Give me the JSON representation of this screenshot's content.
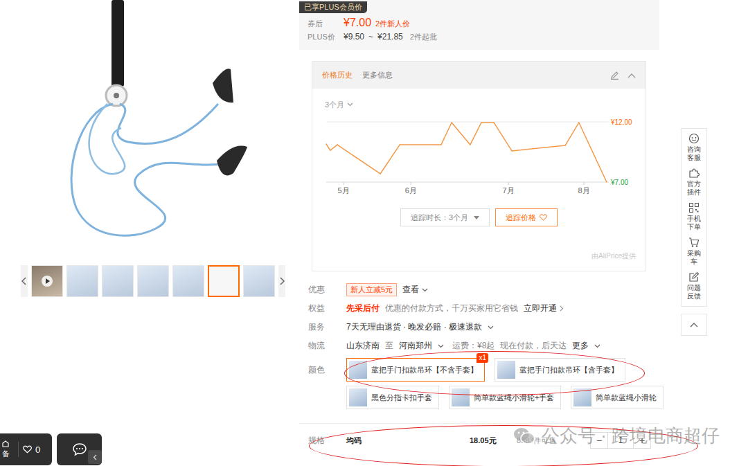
{
  "plus_badge": "已享PLUS会员价",
  "price": {
    "label": "券后",
    "value": "¥7.00",
    "note": "2件新人价"
  },
  "plus_price": {
    "label": "PLUS价",
    "low": "¥9.50",
    "separator": "~",
    "high": "¥21.85",
    "note": "2件起批"
  },
  "gallery": {
    "thumbnails": [
      {
        "kind": "video",
        "selected": false
      },
      {
        "kind": "image",
        "selected": false
      },
      {
        "kind": "image",
        "selected": false
      },
      {
        "kind": "image",
        "selected": false
      },
      {
        "kind": "image",
        "selected": false
      },
      {
        "kind": "image",
        "selected": true
      },
      {
        "kind": "image",
        "selected": false
      }
    ]
  },
  "price_history": {
    "tabs": [
      {
        "label": "价格历史",
        "selected": true
      },
      {
        "label": "更多信息",
        "selected": false
      }
    ],
    "range": "3个月",
    "y_max": 12,
    "y_min": 7,
    "y_max_label": "¥12.00",
    "y_min_label": "¥7.00",
    "months": [
      {
        "label": "5月",
        "day": 5.6
      },
      {
        "label": "6月",
        "day": 27.4
      },
      {
        "label": "7月",
        "day": 59
      },
      {
        "label": "8月",
        "day": 83.4
      }
    ],
    "series": {
      "days": [
        0,
        1.3,
        3.6,
        17.5,
        23.8,
        37.2,
        40.6,
        46.6,
        50.2,
        54.3,
        60.1,
        77.4,
        81.8,
        90.8
      ],
      "values": [
        10.16,
        9.64,
        10.1,
        7.69,
        10.1,
        10.1,
        11.94,
        10.1,
        11.94,
        11.94,
        9.59,
        10.05,
        11.94,
        7.0
      ]
    },
    "track_duration": "追踪时长：3个月",
    "track_price": "追踪价格",
    "provider": "由AliPrice提供"
  },
  "discount": {
    "label": "优惠",
    "tag": "新人立减5元",
    "link": "查看"
  },
  "benefit": {
    "label": "权益",
    "title": "先采后付",
    "text": "优惠的付款方式，千万买家用它省钱",
    "link": "立即开通"
  },
  "service": {
    "label": "服务",
    "text": "7天无理由退货 · 晚发必赔 · 极速退款"
  },
  "logistics": {
    "label": "物流",
    "from": "山东济南",
    "to_word": "至",
    "to": "河南郑州",
    "fee": "运费：¥8起",
    "delivery": "现在付款，后天达",
    "more": "更多"
  },
  "color": {
    "label": "颜色",
    "option_rows": [
      [
        {
          "name": "蓝把手门扣款吊环【不含手套】",
          "selected": true,
          "count": "x1"
        },
        {
          "name": "蓝把手门扣款吊环【含手套】",
          "selected": false
        }
      ],
      [
        {
          "name": "黑色分指卡扣手套",
          "selected": false
        },
        {
          "name": "简单款蓝绳小滑轮+手套",
          "selected": false
        },
        {
          "name": "简单款蓝绳小滑轮",
          "selected": false
        }
      ]
    ]
  },
  "spec": {
    "label": "规格",
    "name": "均码",
    "price": "18.05元",
    "stock": "8883件可售",
    "minus": "−",
    "quantity": "1",
    "plus": "+"
  },
  "toolbar": {
    "items": [
      {
        "label": "咨询客服",
        "kind": "chat"
      },
      {
        "label": "官方插件",
        "kind": "plugin"
      },
      {
        "label": "手机下单",
        "kind": "qrcode"
      },
      {
        "label": "采购车",
        "kind": "cart"
      },
      {
        "label": "问题反馈",
        "kind": "feedback"
      }
    ]
  },
  "floating": {
    "cut_label": "备",
    "favorites": "0"
  },
  "watermark": "公众号 · 跨境电商超仔"
}
